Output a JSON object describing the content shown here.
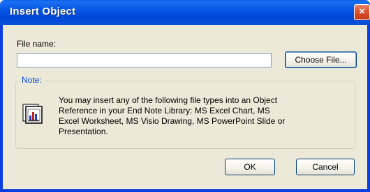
{
  "window": {
    "title": "Insert Object",
    "close_glyph": "×"
  },
  "form": {
    "filename_label": "File name:",
    "filename_value": "",
    "choose_file_label": "Choose File..."
  },
  "note": {
    "legend": "Note:",
    "icon": "ole-object-chart-icon",
    "text": "You may insert any of the following file types into an Object Reference in your End Note Library: MS Excel Chart, MS Excel Worksheet, MS Visio Drawing, MS PowerPoint Slide or Presentation."
  },
  "buttons": {
    "ok_label": "OK",
    "cancel_label": "Cancel"
  },
  "colors": {
    "titlebar": "#0054e3",
    "client": "#ece9d8",
    "legend": "#0046d5",
    "close": "#d9532f"
  }
}
